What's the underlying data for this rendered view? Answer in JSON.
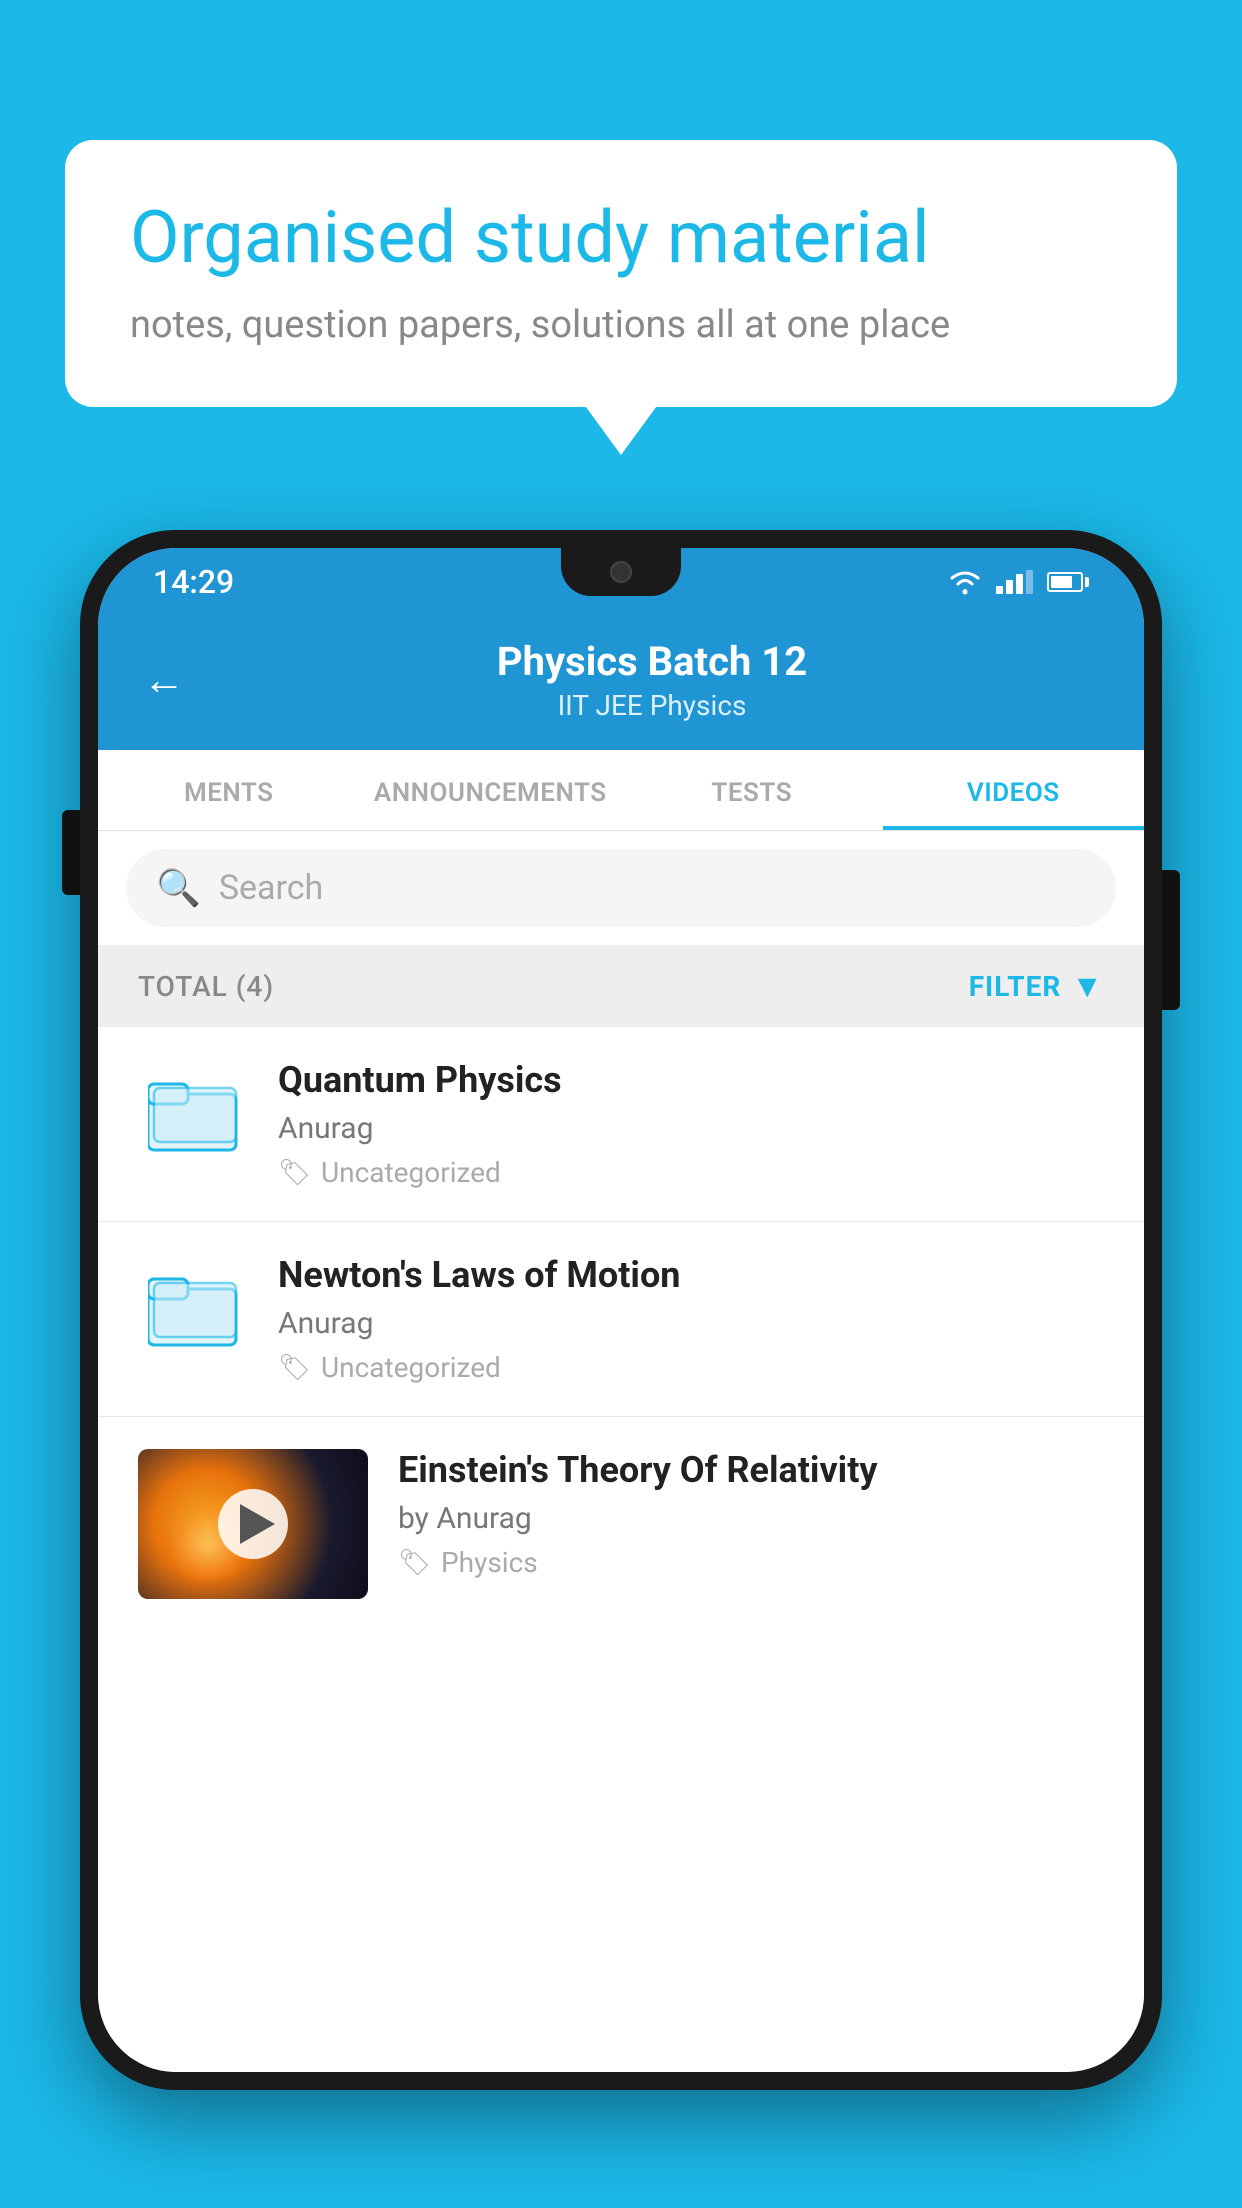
{
  "page": {
    "bg_color": "#1bb8e8"
  },
  "speech_bubble": {
    "title": "Organised study material",
    "subtitle": "notes, question papers, solutions all at one place"
  },
  "status_bar": {
    "time": "14:29"
  },
  "app_header": {
    "title": "Physics Batch 12",
    "subtitle": "IIT JEE   Physics",
    "back_label": "←"
  },
  "tabs": [
    {
      "label": "MENTS",
      "active": false
    },
    {
      "label": "ANNOUNCEMENTS",
      "active": false
    },
    {
      "label": "TESTS",
      "active": false
    },
    {
      "label": "VIDEOS",
      "active": true
    }
  ],
  "search": {
    "placeholder": "Search"
  },
  "filter_bar": {
    "total": "TOTAL (4)",
    "filter_label": "FILTER"
  },
  "video_items": [
    {
      "type": "folder",
      "title": "Quantum Physics",
      "author": "Anurag",
      "tag": "Uncategorized"
    },
    {
      "type": "folder",
      "title": "Newton's Laws of Motion",
      "author": "Anurag",
      "tag": "Uncategorized"
    },
    {
      "type": "video",
      "title": "Einstein's Theory Of Relativity",
      "author": "by Anurag",
      "tag": "Physics"
    }
  ]
}
